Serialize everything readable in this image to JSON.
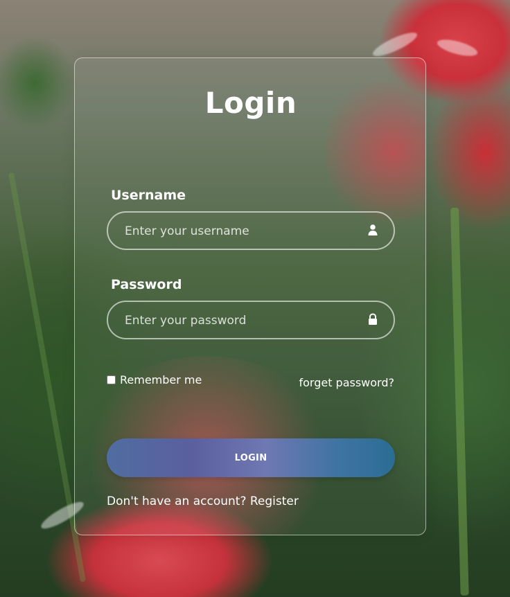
{
  "form": {
    "title": "Login",
    "username": {
      "label": "Username",
      "placeholder": "Enter your username",
      "value": "",
      "icon": "user-icon"
    },
    "password": {
      "label": "Password",
      "placeholder": "Enter your password",
      "value": "",
      "icon": "lock-icon"
    },
    "remember_label": "Remember me",
    "remember_checked": false,
    "forgot_label": "forget password?",
    "login_label": "LOGIN",
    "register_prompt": "Don't have an account?",
    "register_link": "Register"
  },
  "colors": {
    "text": "#ffffff",
    "button_gradient_start": "#4f6da0",
    "button_gradient_mid": "#6f78b2",
    "button_gradient_end": "#2a6d94",
    "card_border": "#ffffff"
  }
}
